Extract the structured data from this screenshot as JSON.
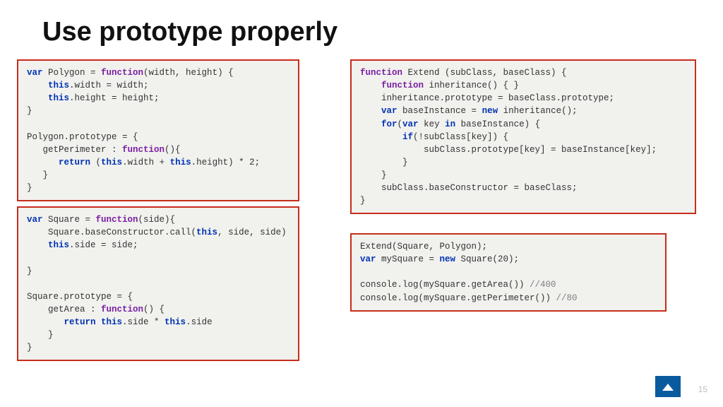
{
  "title": "Use prototype properly",
  "page_number": "15",
  "code": {
    "polygon": {
      "l1a": "var",
      "l1b": " Polygon = ",
      "l1c": "function",
      "l1d": "(width, height) {",
      "l2a": "    ",
      "l2b": "this",
      "l2c": ".width = width;",
      "l3a": "    ",
      "l3b": "this",
      "l3c": ".height = height;",
      "l4": "}",
      "blank1": "",
      "l5": "Polygon.prototype = {",
      "l6a": "   getPerimeter : ",
      "l6b": "function",
      "l6c": "(){",
      "l7a": "      ",
      "l7b": "return",
      "l7c": " (",
      "l7d": "this",
      "l7e": ".width + ",
      "l7f": "this",
      "l7g": ".height) * 2;",
      "l8": "   }",
      "l9": "}"
    },
    "square": {
      "l1a": "var",
      "l1b": " Square = ",
      "l1c": "function",
      "l1d": "(side){",
      "l2a": "    Square.baseConstructor.call(",
      "l2b": "this",
      "l2c": ", side, side)",
      "l3a": "    ",
      "l3b": "this",
      "l3c": ".side = side;",
      "blank1": "",
      "l4": "}",
      "blank2": "",
      "l5": "Square.prototype = {",
      "l6a": "    getArea : ",
      "l6b": "function",
      "l6c": "() {",
      "l7a": "       ",
      "l7b": "return this",
      "l7c": ".side * ",
      "l7d": "this",
      "l7e": ".side",
      "l8": "    }",
      "l9": "}"
    },
    "extend": {
      "l1a": "function",
      "l1b": " Extend (subClass, baseClass) {",
      "l2a": "    ",
      "l2b": "function",
      "l2c": " inheritance() { }",
      "l3a": "    inheritance.prototype = baseClass.prototype;",
      "l4a": "    ",
      "l4b": "var",
      "l4c": " baseInstance = ",
      "l4d": "new",
      "l4e": " inheritance();",
      "l5a": "    ",
      "l5b": "for",
      "l5c": "(",
      "l5d": "var",
      "l5e": " key ",
      "l5f": "in",
      "l5g": " baseInstance) {",
      "l6a": "        ",
      "l6b": "if",
      "l6c": "(!subClass[key]) {",
      "l7": "            subClass.prototype[key] = baseInstance[key];",
      "l8": "        }",
      "l9": "    }",
      "l10": "    subClass.baseConstructor = baseClass;",
      "l11": "}"
    },
    "usage": {
      "l1": "Extend(Square, Polygon);",
      "l2a": "var",
      "l2b": " mySquare = ",
      "l2c": "new",
      "l2d": " Square(20);",
      "blank1": "",
      "l3a": "console.log(mySquare.getArea()) ",
      "l3b": "//400",
      "l4a": "console.log(mySquare.getPerimeter()) ",
      "l4b": "//80"
    }
  }
}
